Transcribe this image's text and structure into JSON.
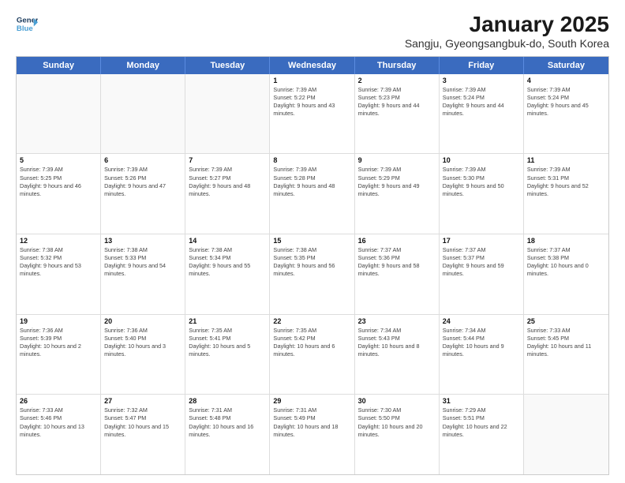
{
  "logo": {
    "line1": "General",
    "line2": "Blue"
  },
  "title": "January 2025",
  "subtitle": "Sangju, Gyeongsangbuk-do, South Korea",
  "header_days": [
    "Sunday",
    "Monday",
    "Tuesday",
    "Wednesday",
    "Thursday",
    "Friday",
    "Saturday"
  ],
  "weeks": [
    [
      {
        "day": "",
        "info": ""
      },
      {
        "day": "",
        "info": ""
      },
      {
        "day": "",
        "info": ""
      },
      {
        "day": "1",
        "info": "Sunrise: 7:39 AM\nSunset: 5:22 PM\nDaylight: 9 hours and 43 minutes."
      },
      {
        "day": "2",
        "info": "Sunrise: 7:39 AM\nSunset: 5:23 PM\nDaylight: 9 hours and 44 minutes."
      },
      {
        "day": "3",
        "info": "Sunrise: 7:39 AM\nSunset: 5:24 PM\nDaylight: 9 hours and 44 minutes."
      },
      {
        "day": "4",
        "info": "Sunrise: 7:39 AM\nSunset: 5:24 PM\nDaylight: 9 hours and 45 minutes."
      }
    ],
    [
      {
        "day": "5",
        "info": "Sunrise: 7:39 AM\nSunset: 5:25 PM\nDaylight: 9 hours and 46 minutes."
      },
      {
        "day": "6",
        "info": "Sunrise: 7:39 AM\nSunset: 5:26 PM\nDaylight: 9 hours and 47 minutes."
      },
      {
        "day": "7",
        "info": "Sunrise: 7:39 AM\nSunset: 5:27 PM\nDaylight: 9 hours and 48 minutes."
      },
      {
        "day": "8",
        "info": "Sunrise: 7:39 AM\nSunset: 5:28 PM\nDaylight: 9 hours and 48 minutes."
      },
      {
        "day": "9",
        "info": "Sunrise: 7:39 AM\nSunset: 5:29 PM\nDaylight: 9 hours and 49 minutes."
      },
      {
        "day": "10",
        "info": "Sunrise: 7:39 AM\nSunset: 5:30 PM\nDaylight: 9 hours and 50 minutes."
      },
      {
        "day": "11",
        "info": "Sunrise: 7:39 AM\nSunset: 5:31 PM\nDaylight: 9 hours and 52 minutes."
      }
    ],
    [
      {
        "day": "12",
        "info": "Sunrise: 7:38 AM\nSunset: 5:32 PM\nDaylight: 9 hours and 53 minutes."
      },
      {
        "day": "13",
        "info": "Sunrise: 7:38 AM\nSunset: 5:33 PM\nDaylight: 9 hours and 54 minutes."
      },
      {
        "day": "14",
        "info": "Sunrise: 7:38 AM\nSunset: 5:34 PM\nDaylight: 9 hours and 55 minutes."
      },
      {
        "day": "15",
        "info": "Sunrise: 7:38 AM\nSunset: 5:35 PM\nDaylight: 9 hours and 56 minutes."
      },
      {
        "day": "16",
        "info": "Sunrise: 7:37 AM\nSunset: 5:36 PM\nDaylight: 9 hours and 58 minutes."
      },
      {
        "day": "17",
        "info": "Sunrise: 7:37 AM\nSunset: 5:37 PM\nDaylight: 9 hours and 59 minutes."
      },
      {
        "day": "18",
        "info": "Sunrise: 7:37 AM\nSunset: 5:38 PM\nDaylight: 10 hours and 0 minutes."
      }
    ],
    [
      {
        "day": "19",
        "info": "Sunrise: 7:36 AM\nSunset: 5:39 PM\nDaylight: 10 hours and 2 minutes."
      },
      {
        "day": "20",
        "info": "Sunrise: 7:36 AM\nSunset: 5:40 PM\nDaylight: 10 hours and 3 minutes."
      },
      {
        "day": "21",
        "info": "Sunrise: 7:35 AM\nSunset: 5:41 PM\nDaylight: 10 hours and 5 minutes."
      },
      {
        "day": "22",
        "info": "Sunrise: 7:35 AM\nSunset: 5:42 PM\nDaylight: 10 hours and 6 minutes."
      },
      {
        "day": "23",
        "info": "Sunrise: 7:34 AM\nSunset: 5:43 PM\nDaylight: 10 hours and 8 minutes."
      },
      {
        "day": "24",
        "info": "Sunrise: 7:34 AM\nSunset: 5:44 PM\nDaylight: 10 hours and 9 minutes."
      },
      {
        "day": "25",
        "info": "Sunrise: 7:33 AM\nSunset: 5:45 PM\nDaylight: 10 hours and 11 minutes."
      }
    ],
    [
      {
        "day": "26",
        "info": "Sunrise: 7:33 AM\nSunset: 5:46 PM\nDaylight: 10 hours and 13 minutes."
      },
      {
        "day": "27",
        "info": "Sunrise: 7:32 AM\nSunset: 5:47 PM\nDaylight: 10 hours and 15 minutes."
      },
      {
        "day": "28",
        "info": "Sunrise: 7:31 AM\nSunset: 5:48 PM\nDaylight: 10 hours and 16 minutes."
      },
      {
        "day": "29",
        "info": "Sunrise: 7:31 AM\nSunset: 5:49 PM\nDaylight: 10 hours and 18 minutes."
      },
      {
        "day": "30",
        "info": "Sunrise: 7:30 AM\nSunset: 5:50 PM\nDaylight: 10 hours and 20 minutes."
      },
      {
        "day": "31",
        "info": "Sunrise: 7:29 AM\nSunset: 5:51 PM\nDaylight: 10 hours and 22 minutes."
      },
      {
        "day": "",
        "info": ""
      }
    ]
  ]
}
